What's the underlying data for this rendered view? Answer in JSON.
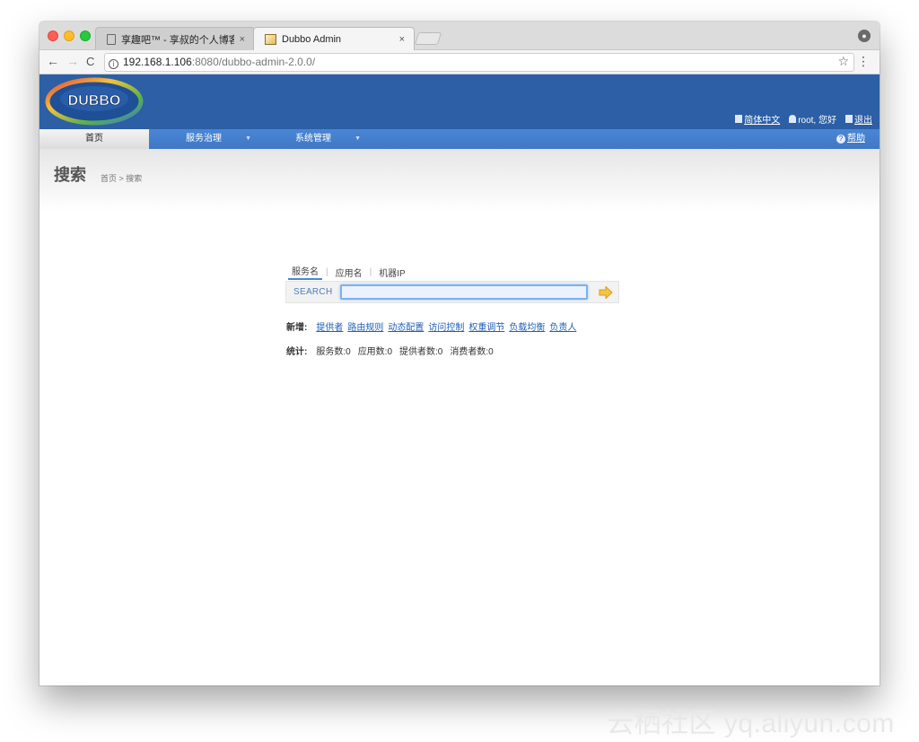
{
  "browser": {
    "tabs": [
      {
        "title": "享趣吧™ - 享叔的个人博客, 一",
        "close": "×"
      },
      {
        "title": "Dubbo Admin",
        "close": "×"
      }
    ],
    "url_host": "192.168.1.106",
    "url_rest": ":8080/dubbo-admin-2.0.0/"
  },
  "header": {
    "logo_text": "DUBBO",
    "lang_link": "简体中文",
    "user_greeting": "root, 您好",
    "logout": "退出"
  },
  "menu": {
    "home": "首页",
    "service": "服务治理",
    "system": "系统管理",
    "help": "帮助"
  },
  "page": {
    "title": "搜索",
    "breadcrumb": "首页 > 搜索"
  },
  "search": {
    "tabs": [
      "服务名",
      "应用名",
      "机器IP"
    ],
    "label": "SEARCH",
    "value": ""
  },
  "new_row": {
    "label": "新增:",
    "links": [
      "提供者",
      "路由规则",
      "动态配置",
      "访问控制",
      "权重调节",
      "负载均衡",
      "负责人"
    ]
  },
  "stats": {
    "label": "统计:",
    "items": [
      "服务数:0",
      "应用数:0",
      "提供者数:0",
      "消费者数:0"
    ]
  },
  "watermark": "云栖社区 yq.aliyun.com"
}
